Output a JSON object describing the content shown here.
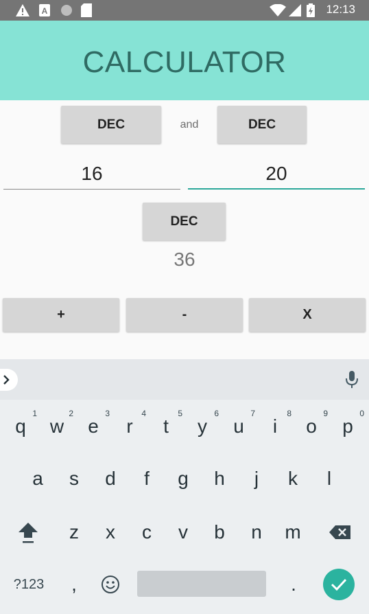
{
  "status_bar": {
    "time": "12:13",
    "icons": [
      "warning-icon",
      "font-a-icon",
      "circle-icon",
      "sd-card-icon",
      "wifi-icon",
      "signal-icon",
      "battery-charging-icon"
    ]
  },
  "app_bar": {
    "title": "CALCULATOR"
  },
  "calculator": {
    "base_left_label": "DEC",
    "and_label": "and",
    "base_right_label": "DEC",
    "operand_left": "16",
    "operand_right": "20",
    "result_base_label": "DEC",
    "result": "36",
    "op_add": "+",
    "op_subtract": "-",
    "op_multiply": "X"
  },
  "keyboard": {
    "row1": [
      {
        "key": "q",
        "hint": "1"
      },
      {
        "key": "w",
        "hint": "2"
      },
      {
        "key": "e",
        "hint": "3"
      },
      {
        "key": "r",
        "hint": "4"
      },
      {
        "key": "t",
        "hint": "5"
      },
      {
        "key": "y",
        "hint": "6"
      },
      {
        "key": "u",
        "hint": "7"
      },
      {
        "key": "i",
        "hint": "8"
      },
      {
        "key": "o",
        "hint": "9"
      },
      {
        "key": "p",
        "hint": "0"
      }
    ],
    "row2": [
      "a",
      "s",
      "d",
      "f",
      "g",
      "h",
      "j",
      "k",
      "l"
    ],
    "row3": [
      "z",
      "x",
      "c",
      "v",
      "b",
      "n",
      "m"
    ],
    "symbols_label": "?123",
    "comma": ",",
    "period": ".",
    "accent_color": "#2bb39f"
  }
}
